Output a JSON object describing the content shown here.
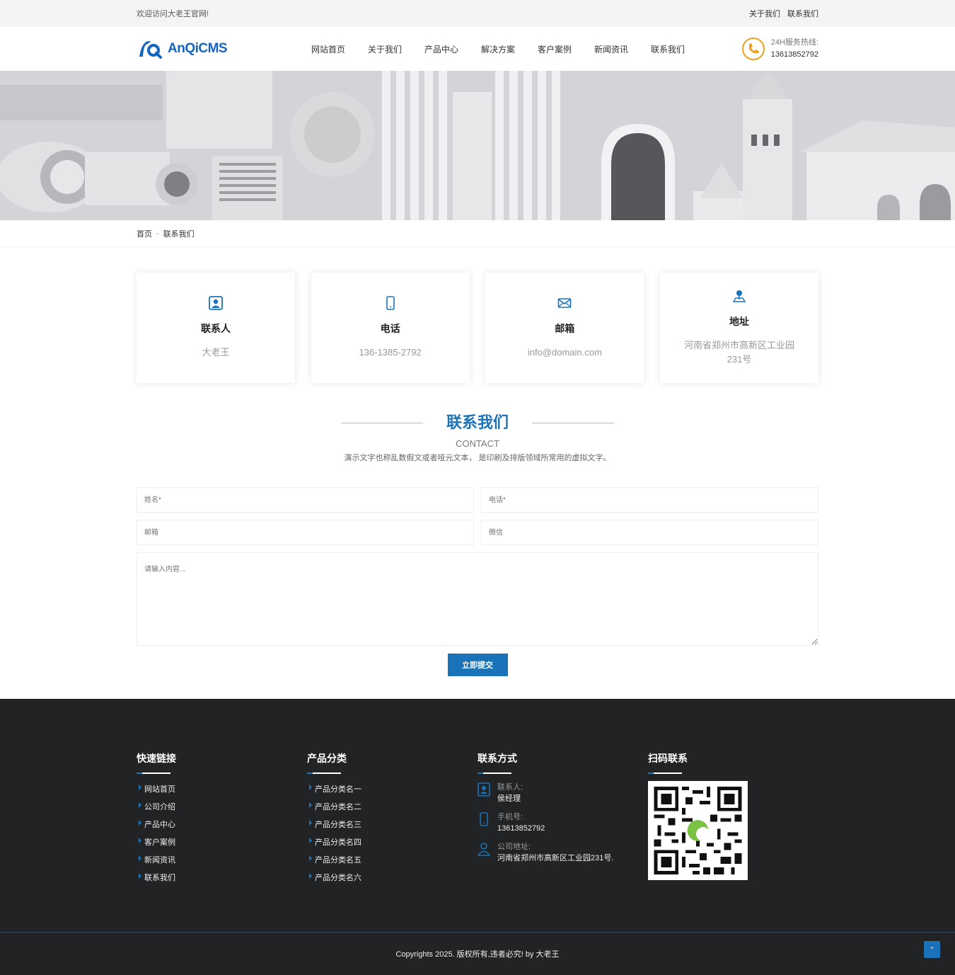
{
  "topbar": {
    "welcome": "欢迎访问大老王官网!",
    "links": [
      "关于我们",
      "联系我们"
    ]
  },
  "header": {
    "logo_text": "AnQiCMS",
    "nav": [
      "网站首页",
      "关于我们",
      "产品中心",
      "解决方案",
      "客户案例",
      "新闻资讯",
      "联系我们"
    ],
    "hotline_label": "24H服务热线:",
    "hotline_number": "13613852792"
  },
  "breadcrumb": {
    "home": "首页",
    "sep": "-",
    "current": "联系我们"
  },
  "cards": [
    {
      "icon": "contact-person-icon",
      "title": "联系人",
      "value": "大老王"
    },
    {
      "icon": "phone-icon",
      "title": "电话",
      "value": "136-1385-2792"
    },
    {
      "icon": "mail-icon",
      "title": "邮箱",
      "value": "info@domain.com"
    },
    {
      "icon": "location-icon",
      "title": "地址",
      "value": "河南省郑州市高新区工业园231号"
    }
  ],
  "section": {
    "title": "联系我们",
    "subtitle": "CONTACT",
    "desc": "演示文字也称乱数假文或者哑元文本， 是印刷及排版领域所常用的虚拟文字。"
  },
  "form": {
    "name_placeholder": "姓名*",
    "phone_placeholder": "电话*",
    "email_placeholder": "邮箱",
    "wechat_placeholder": "微信",
    "content_placeholder": "请输入内容...",
    "submit_label": "立即提交"
  },
  "footer": {
    "quick_links_title": "快速链接",
    "quick_links": [
      "网站首页",
      "公司介绍",
      "产品中心",
      "客户案例",
      "新闻资讯",
      "联系我们"
    ],
    "category_title": "产品分类",
    "categories": [
      "产品分类名一",
      "产品分类名二",
      "产品分类名三",
      "产品分类名四",
      "产品分类名五",
      "产品分类名六"
    ],
    "contact_title": "联系方式",
    "contact": {
      "person_label": "联系人:",
      "person": "侯经理",
      "mobile_label": "手机号:",
      "mobile": "13613852792",
      "address_label": "公司地址:",
      "address": "河南省郑州市高新区工业园231号."
    },
    "qr_title": "扫码联系",
    "copyright": "Copyrights 2025. 版权所有,违者必究! by 大老王",
    "totop_label": "⌃"
  },
  "colors": {
    "accent": "#1a73b8",
    "footer_bg": "#222324",
    "hotline_orange": "#f0a020"
  }
}
